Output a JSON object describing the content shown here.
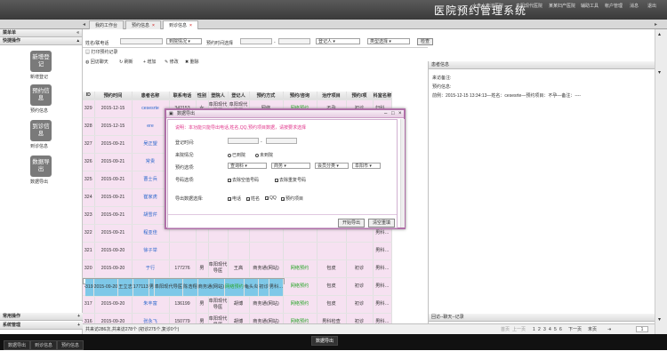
{
  "app": {
    "title": "医院预约管理系统"
  },
  "topnav": [
    "六盘水李洁医院",
    "阜阳现代医院",
    "某某妇产医院",
    "辅助工具",
    "帐户管理",
    "消息",
    "退出"
  ],
  "tabs": [
    {
      "label": "我的工作台",
      "active": false
    },
    {
      "label": "预约信息",
      "active": false
    },
    {
      "label": "到诊信息",
      "active": true
    }
  ],
  "sidebar": {
    "header": "菜单单",
    "section": "快捷操作",
    "items": [
      {
        "icon": "新增登记",
        "label": "新增登记"
      },
      {
        "icon": "预约信息",
        "label": "预约信息"
      },
      {
        "icon": "到诊信息",
        "label": "到诊信息"
      },
      {
        "icon": "数据导出",
        "label": "数据导出"
      }
    ],
    "bottom": [
      "常用操作",
      "系统管理"
    ]
  },
  "filters": {
    "name_label": "姓名/联电话",
    "visit_select": "到院情况",
    "time_label": "预约时间选择",
    "dash": "-",
    "registrar_select": "登记人",
    "type_select": "类型选择",
    "search_btn": "检查"
  },
  "toolbar": [
    "打印预约记录",
    "回访聊天",
    "刷新",
    "增加",
    "修改",
    "删除"
  ],
  "columns": [
    "ID",
    "预约时间",
    "患者名称",
    "联系电话",
    "性别",
    "登院人",
    "登记人",
    "预约方式",
    "预约/咨询",
    "治疗项目",
    "预约/项",
    "科室名称"
  ],
  "rows": [
    {
      "id": "329",
      "date": "2015-12-15",
      "name": "cesesrte",
      "phone": "342153",
      "sex": "女",
      "reg": "阜阳现代导医",
      "reg2": "阜阳现代导医",
      "way": "网络",
      "adv": "网络预约",
      "item": "不孕",
      "cons": "初诊",
      "dept": "妇科…",
      "style": "pink"
    },
    {
      "id": "328",
      "date": "2015-12-15",
      "name": "ere",
      "phone": "142123",
      "sex": "女",
      "reg": "杜明",
      "reg2": "杜明",
      "way": "网络",
      "adv": "网络预约",
      "item": "其他",
      "cons": "初诊",
      "dept": "综合科",
      "style": "pink"
    },
    {
      "id": "327",
      "date": "2015-09-21",
      "name": "吴正望",
      "phone": "",
      "sex": "",
      "reg": "",
      "reg2": "",
      "way": "",
      "adv": "",
      "item": "",
      "cons": "",
      "dept": "男科…",
      "style": "pink"
    },
    {
      "id": "326",
      "date": "2015-09-21",
      "name": "常贵",
      "phone": "",
      "sex": "",
      "reg": "",
      "reg2": "",
      "way": "",
      "adv": "",
      "item": "",
      "cons": "",
      "dept": "男科…",
      "style": "pink"
    },
    {
      "id": "325",
      "date": "2015-09-21",
      "name": "曹士兵",
      "phone": "",
      "sex": "",
      "reg": "",
      "reg2": "",
      "way": "",
      "adv": "",
      "item": "",
      "cons": "",
      "dept": "男科…",
      "style": "pink"
    },
    {
      "id": "324",
      "date": "2015-09-21",
      "name": "崔家虎",
      "phone": "",
      "sex": "",
      "reg": "",
      "reg2": "",
      "way": "",
      "adv": "",
      "item": "",
      "cons": "",
      "dept": "男科…",
      "style": "pink"
    },
    {
      "id": "323",
      "date": "2015-09-21",
      "name": "胡雪芹",
      "phone": "",
      "sex": "",
      "reg": "",
      "reg2": "",
      "way": "",
      "adv": "",
      "item": "",
      "cons": "",
      "dept": "男科…",
      "style": "pink"
    },
    {
      "id": "322",
      "date": "2015-09-21",
      "name": "程亚佳",
      "phone": "",
      "sex": "",
      "reg": "",
      "reg2": "",
      "way": "",
      "adv": "",
      "item": "",
      "cons": "",
      "dept": "男科…",
      "style": "pink"
    },
    {
      "id": "321",
      "date": "2015-09-20",
      "name": "徐子举",
      "phone": "",
      "sex": "",
      "reg": "",
      "reg2": "",
      "way": "",
      "adv": "",
      "item": "",
      "cons": "",
      "dept": "男科…",
      "style": "pink"
    },
    {
      "id": "320",
      "date": "2015-09-20",
      "name": "于行",
      "phone": "177276",
      "sex": "男",
      "reg": "阜阳现代导医",
      "reg2": "王高",
      "way": "商务通(网站)",
      "adv": "网络预约",
      "item": "包皮",
      "cons": "初诊",
      "dept": "男科…",
      "style": "pink"
    },
    {
      "id": "319",
      "date": "2015-09-20",
      "name": "王立志",
      "phone": "177113",
      "sex": "男",
      "reg": "阜阳现代导医",
      "reg2": "陈浩翔",
      "way": "商务通(网站)",
      "adv": "网络预约",
      "item": "龟头炎",
      "cons": "初诊",
      "dept": "男科…",
      "style": "sel"
    },
    {
      "id": "318",
      "date": "2015-09-20",
      "name": "杜禄",
      "phone": "188399",
      "sex": "男",
      "reg": "阜阳现代导医",
      "reg2": "胡博",
      "way": "商务通(网站)",
      "adv": "网络预约",
      "item": "包皮",
      "cons": "初诊",
      "dept": "男科…",
      "style": "pink"
    },
    {
      "id": "317",
      "date": "2015-09-20",
      "name": "朱丰富",
      "phone": "136199",
      "sex": "男",
      "reg": "阜阳现代导医",
      "reg2": "胡博",
      "way": "商务通(网站)",
      "adv": "网络预约",
      "item": "包皮",
      "cons": "初诊",
      "dept": "男科…",
      "style": "pink"
    },
    {
      "id": "316",
      "date": "2015-09-20",
      "name": "张永飞",
      "phone": "150779",
      "sex": "男",
      "reg": "阜阳现代导医",
      "reg2": "胡博",
      "way": "商务通(网站)",
      "adv": "网络预约",
      "item": "男科检查",
      "cons": "初诊",
      "dept": "男科…",
      "style": "pink"
    }
  ],
  "status": "共来访286次,共来访278个 (初诊275个,复诊0个)",
  "right_panel": {
    "title": "患者信息",
    "line1": "来访备注:",
    "line2": "预约信息:",
    "line3": "前例：2015-12-15 13:34:13—姓名：cesesrte—预约项目：不孕—备注：----",
    "footer": "回访--聊天--记录"
  },
  "pager": {
    "prefix": "首页",
    "prev": "上一页",
    "pages": [
      "1",
      "2",
      "3",
      "4",
      "5",
      "6"
    ],
    "next": "下一页",
    "last": "末页",
    "current": "1"
  },
  "modal": {
    "title": "数据导出",
    "hint": "说明：本功能只能导出电话,姓名,QQ,预约项目数据，请按要求选择",
    "reg_time": "登记时间:",
    "visit": "来院情况:",
    "visit_opts": [
      "已到院",
      "未到院"
    ],
    "appt_opts": "预约选项:",
    "appt_selects": [
      "查询科",
      "商务",
      "会员分类",
      "阜阳市"
    ],
    "phone_opts": "号码选项:",
    "phone_cbs": [
      "去除空值号码",
      "去除重复号码"
    ],
    "export_opts": "导出数据选择:",
    "export_cbs": [
      "电话",
      "姓名",
      "QQ",
      "预约项目"
    ],
    "btn_export": "开始导出",
    "btn_reset": "清空重填"
  },
  "taskbar": {
    "left": [
      "数据导出"
    ],
    "items": [
      "到诊信息",
      "预约信息"
    ],
    "center": "数据导出"
  }
}
